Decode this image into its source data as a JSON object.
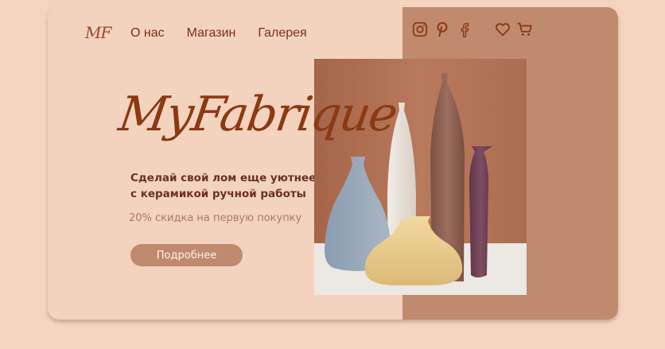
{
  "header": {
    "logo": "MF",
    "nav": [
      "О нас",
      "Магазин",
      "Галерея"
    ],
    "icons": [
      "instagram-icon",
      "pinterest-icon",
      "facebook-icon",
      "heart-icon",
      "cart-icon"
    ]
  },
  "hero": {
    "brand": "MyFabrique",
    "tagline": "Сделай свой лом еще уютнее\nс керамикой ручной работы",
    "discount": "20% скидка на первую покупку",
    "cta_label": "Подробнее"
  },
  "colors": {
    "page_bg": "#f5d4bf",
    "card_bg": "#f3d2be",
    "accent": "#c08a6e",
    "text_dark": "#7a3318",
    "brand": "#8a3a14"
  }
}
